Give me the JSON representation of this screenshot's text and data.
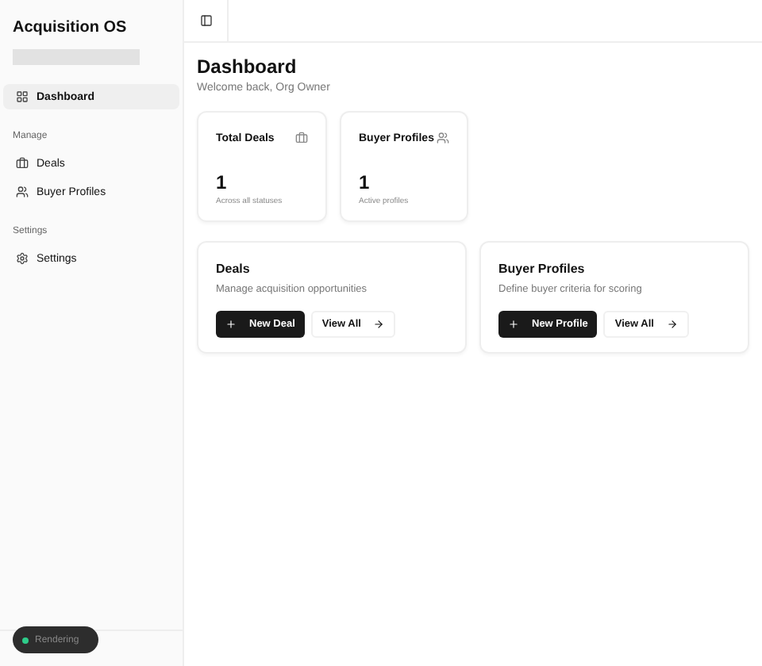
{
  "sidebar": {
    "title": "Acquisition OS",
    "groups": [
      {
        "items": [
          {
            "label": "Dashboard",
            "kind": "grid",
            "selected": true
          }
        ]
      },
      {
        "heading": "Manage",
        "items": [
          {
            "label": "Deals",
            "kind": "briefcase",
            "selected": false
          },
          {
            "label": "Buyer Profiles",
            "kind": "users",
            "selected": false
          }
        ]
      },
      {
        "heading": "Settings",
        "items": [
          {
            "label": "Settings",
            "kind": "gear",
            "selected": false
          }
        ]
      }
    ]
  },
  "toast": {
    "label": "Rendering"
  },
  "page": {
    "title": "Dashboard",
    "subtitle": "Welcome back, Org Owner"
  },
  "stats": [
    {
      "label": "Total Deals",
      "kind": "briefcase",
      "value": "1",
      "caption": "Across all statuses"
    },
    {
      "label": "Buyer Profiles",
      "kind": "users",
      "value": "1",
      "caption": "Active profiles"
    }
  ],
  "actions": [
    {
      "title": "Deals",
      "description": "Manage acquisition opportunities",
      "primary": "New Deal",
      "secondary": "View All"
    },
    {
      "title": "Buyer Profiles",
      "description": "Define buyer criteria for scoring",
      "primary": "New Profile",
      "secondary": "View All"
    }
  ]
}
